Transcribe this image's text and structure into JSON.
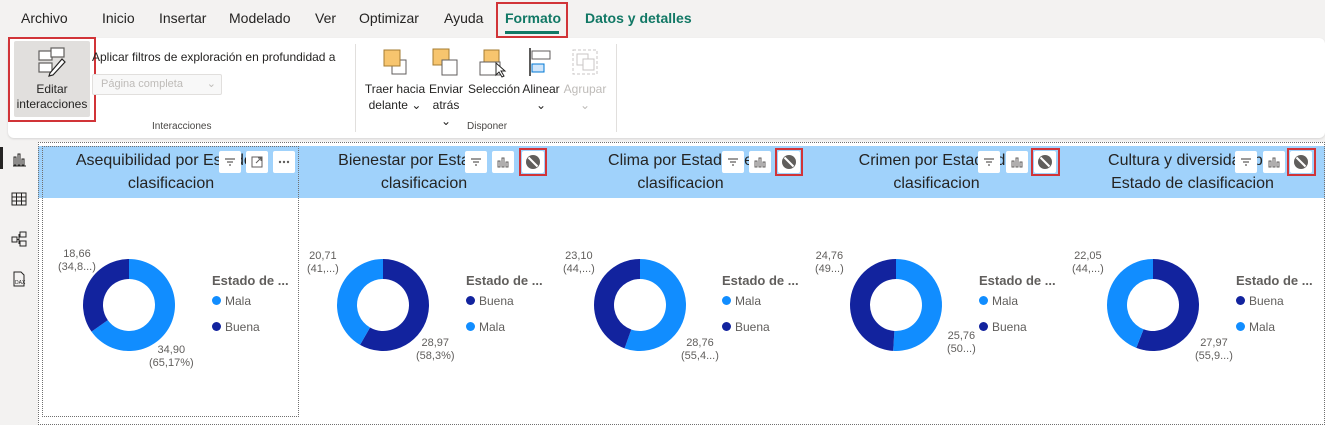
{
  "menu": {
    "archivo": "Archivo",
    "inicio": "Inicio",
    "insertar": "Insertar",
    "modelado": "Modelado",
    "ver": "Ver",
    "optimizar": "Optimizar",
    "ayuda": "Ayuda",
    "formato": "Formato",
    "datos_detalles": "Datos y detalles"
  },
  "ribbon": {
    "editar_line1": "Editar",
    "editar_line2": "interacciones",
    "filtros_label": "Aplicar filtros de exploración en profundidad a",
    "filtros_value": "Página completa",
    "interacciones_group": "Interacciones",
    "traer_line1": "Traer hacia",
    "traer_line2": "delante",
    "enviar_line1": "Enviar",
    "enviar_line2": "atrás",
    "seleccion": "Selección",
    "alinear": "Alinear",
    "agrupar": "Agrupar",
    "disponer_group": "Disponer"
  },
  "visuals": [
    {
      "title_line1": "Asequibilidad por Estado d",
      "title_line2": "clasificacion",
      "label_a_1": "18,66",
      "label_a_2": "(34,8...)",
      "label_b_1": "34,90",
      "label_b_2": "(65,17%)",
      "legend_title": "Estado de ...",
      "legend_1": "Mala",
      "legend_2": "Buena"
    },
    {
      "title_line1": "Bienestar por Estado de",
      "title_line2": "clasificacion",
      "label_a_1": "20,71",
      "label_a_2": "(41,...)",
      "label_b_1": "28,97",
      "label_b_2": "(58,3%)",
      "legend_title": "Estado de ...",
      "legend_1": "Buena",
      "legend_2": "Mala"
    },
    {
      "title_line1": "Clima por Estado de",
      "title_line2": "clasificacion",
      "label_a_1": "23,10",
      "label_a_2": "(44,...)",
      "label_b_1": "28,76",
      "label_b_2": "(55,4...)",
      "legend_title": "Estado de ...",
      "legend_1": "Mala",
      "legend_2": "Buena"
    },
    {
      "title_line1": "Crimen por Estado de",
      "title_line2": "clasificacion",
      "label_a_1": "24,76",
      "label_a_2": "(49...)",
      "label_b_1": "25,76",
      "label_b_2": "(50...)",
      "legend_title": "Estado de ...",
      "legend_1": "Mala",
      "legend_2": "Buena"
    },
    {
      "title_line1": "Cultura y diversidad por",
      "title_line2": "Estado de clasificacion",
      "label_a_1": "22,05",
      "label_a_2": "(44,...)",
      "label_b_1": "27,97",
      "label_b_2": "(55,9...)",
      "legend_title": "Estado de ...",
      "legend_1": "Buena",
      "legend_2": "Mala"
    }
  ],
  "chart_data": [
    {
      "type": "pie",
      "categories": [
        "Mala",
        "Buena"
      ],
      "values": [
        34.9,
        18.66
      ],
      "colors": [
        "#118dff",
        "#12239e"
      ]
    },
    {
      "type": "pie",
      "categories": [
        "Buena",
        "Mala"
      ],
      "values": [
        28.97,
        20.71
      ],
      "colors": [
        "#12239e",
        "#118dff"
      ]
    },
    {
      "type": "pie",
      "categories": [
        "Mala",
        "Buena"
      ],
      "values": [
        28.76,
        23.1
      ],
      "colors": [
        "#118dff",
        "#12239e"
      ]
    },
    {
      "type": "pie",
      "categories": [
        "Mala",
        "Buena"
      ],
      "values": [
        25.76,
        24.76
      ],
      "colors": [
        "#118dff",
        "#12239e"
      ]
    },
    {
      "type": "pie",
      "categories": [
        "Buena",
        "Mala"
      ],
      "values": [
        27.97,
        22.05
      ],
      "colors": [
        "#12239e",
        "#118dff"
      ]
    }
  ],
  "colors": {
    "accent": "#117865",
    "highlight": "#d13438",
    "title_band": "#a0d2fb",
    "series_light": "#118dff",
    "series_dark": "#12239e"
  },
  "icons": {
    "report_view": "bar-chart-icon",
    "data_view": "table-grid-icon",
    "model_view": "model-icon",
    "dax_view": "dax-icon"
  }
}
